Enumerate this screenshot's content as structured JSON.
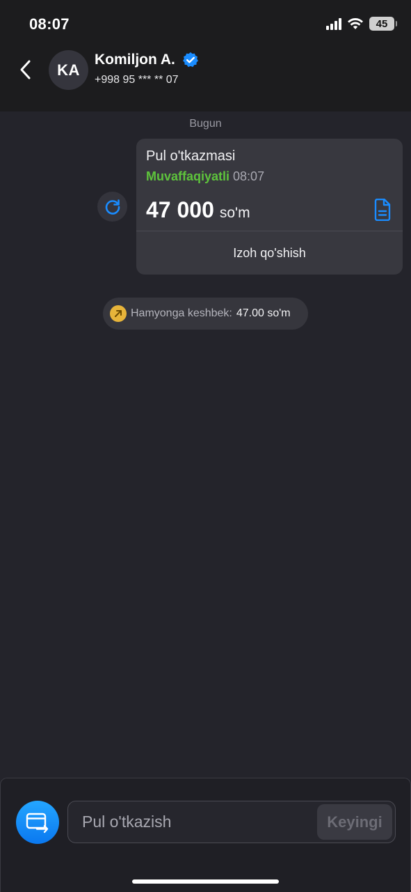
{
  "status_bar": {
    "time": "08:07",
    "battery": "45"
  },
  "header": {
    "avatar_initials": "KA",
    "name": "Komiljon A.",
    "phone": "+998 95 *** ** 07",
    "verified_color": "#1a8cff"
  },
  "chat": {
    "date_label": "Bugun",
    "transfer": {
      "title": "Pul o'tkazmasi",
      "status": "Muvaffaqiyatli",
      "time": "08:07",
      "amount": "47 000",
      "currency": "so'm",
      "comment_label": "Izoh qo'shish"
    },
    "cashback": {
      "label": "Hamyonga keshbek:",
      "value": "47.00 so'm"
    }
  },
  "composer": {
    "placeholder": "Pul o'tkazish",
    "value": "",
    "next_label": "Keyingi"
  },
  "colors": {
    "accent": "#1a8cff",
    "success": "#5ec43c",
    "background": "#24242b"
  }
}
